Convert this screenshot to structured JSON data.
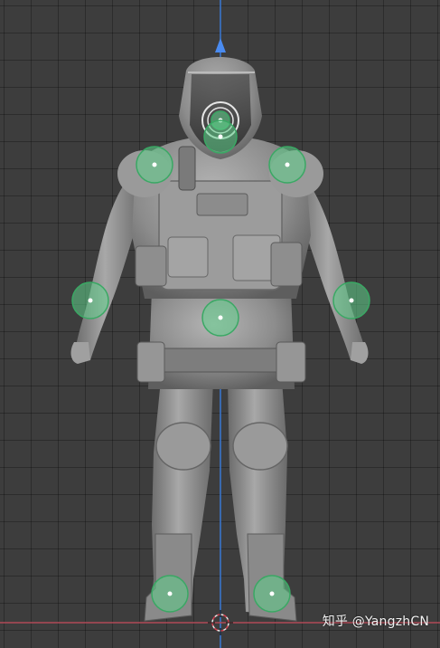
{
  "watermark": {
    "text": "知乎 @YangzhCN"
  },
  "colors": {
    "background": "#3d3d3d",
    "grid": "#2e2e2e",
    "z_axis": "#3d7bd6",
    "x_axis": "#b04a56",
    "model": "#8e8e8e",
    "bone_handle": "#5fd08a",
    "bone_outline": "#3aa864"
  },
  "icons": {
    "up_arrow": "axis-arrow-icon",
    "cursor": "3d-cursor-icon",
    "bone_handle": "bone-handle-icon"
  },
  "bone_handles": [
    {
      "name": "head"
    },
    {
      "name": "neck"
    },
    {
      "name": "shoulder-left"
    },
    {
      "name": "shoulder-right"
    },
    {
      "name": "hand-left"
    },
    {
      "name": "hand-right"
    },
    {
      "name": "hips"
    },
    {
      "name": "foot-left"
    },
    {
      "name": "foot-right"
    }
  ]
}
